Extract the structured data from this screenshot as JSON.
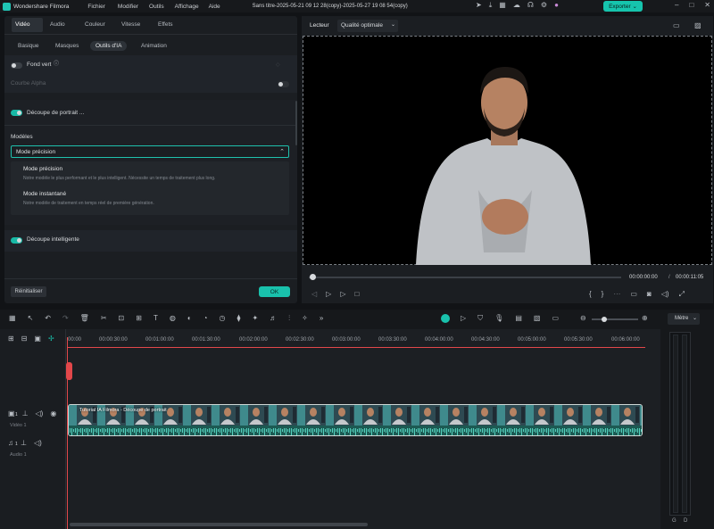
{
  "app": {
    "title": "Wondershare Filmora",
    "project_title": "Sans titre-2025-05-21 09 12 28(copy)-2025-05-27 19 08 54(copy)",
    "export_label": "Exporter"
  },
  "menu": [
    "Fichier",
    "Modifier",
    "Outils",
    "Affichage",
    "Aide"
  ],
  "panel": {
    "tabs": [
      "Vidéo",
      "Audio",
      "Couleur",
      "Vitesse",
      "Effets"
    ],
    "subtabs": [
      "Basique",
      "Masques",
      "Outils d'IA",
      "Animation"
    ],
    "fond_vert": "Fond vert",
    "courbe_alpha": "Courbe Alpha",
    "decoupe_portrait": "Découpe de portrait ...",
    "modeles_label": "Modèles",
    "selected_model": "Mode précision",
    "options": [
      {
        "name": "Mode précision",
        "desc": "Notre modèle le plus performant et le plus intelligent. Nécessite un temps de traitement plus long."
      },
      {
        "name": "Mode instantané",
        "desc": "Notre modèle de traitement en temps réel de première génération."
      }
    ],
    "decoupe_intelligente": "Découpe intelligente",
    "reset_label": "Réinitialiser",
    "ok_label": "OK"
  },
  "player": {
    "label": "Lecteur",
    "quality": "Qualité optimale",
    "current_time": "00:00:00:00",
    "separator": "/",
    "total_time": "00:00:11:05"
  },
  "timeline": {
    "ruler": [
      "00:00",
      "00:00:30:00",
      "00:01:00:00",
      "00:01:30:00",
      "00:02:00:00",
      "00:02:30:00",
      "00:03:00:00",
      "00:03:30:00",
      "00:04:00:00",
      "00:04:30:00",
      "00:05:00:00",
      "00:05:30:00",
      "00:06:00:00"
    ],
    "video_track": "Vidéo 1",
    "audio_track": "Audio 1",
    "track_num_video": "1",
    "track_num_audio": "1",
    "clip_title": "Tutorial IA Filmora - Découpe de portrait"
  },
  "meter": {
    "mode": "Mètre",
    "left": "G",
    "right": "D"
  },
  "colors": {
    "accent": "#19c1ac",
    "playhead": "#e2474a",
    "clip": "#1d5f59"
  }
}
